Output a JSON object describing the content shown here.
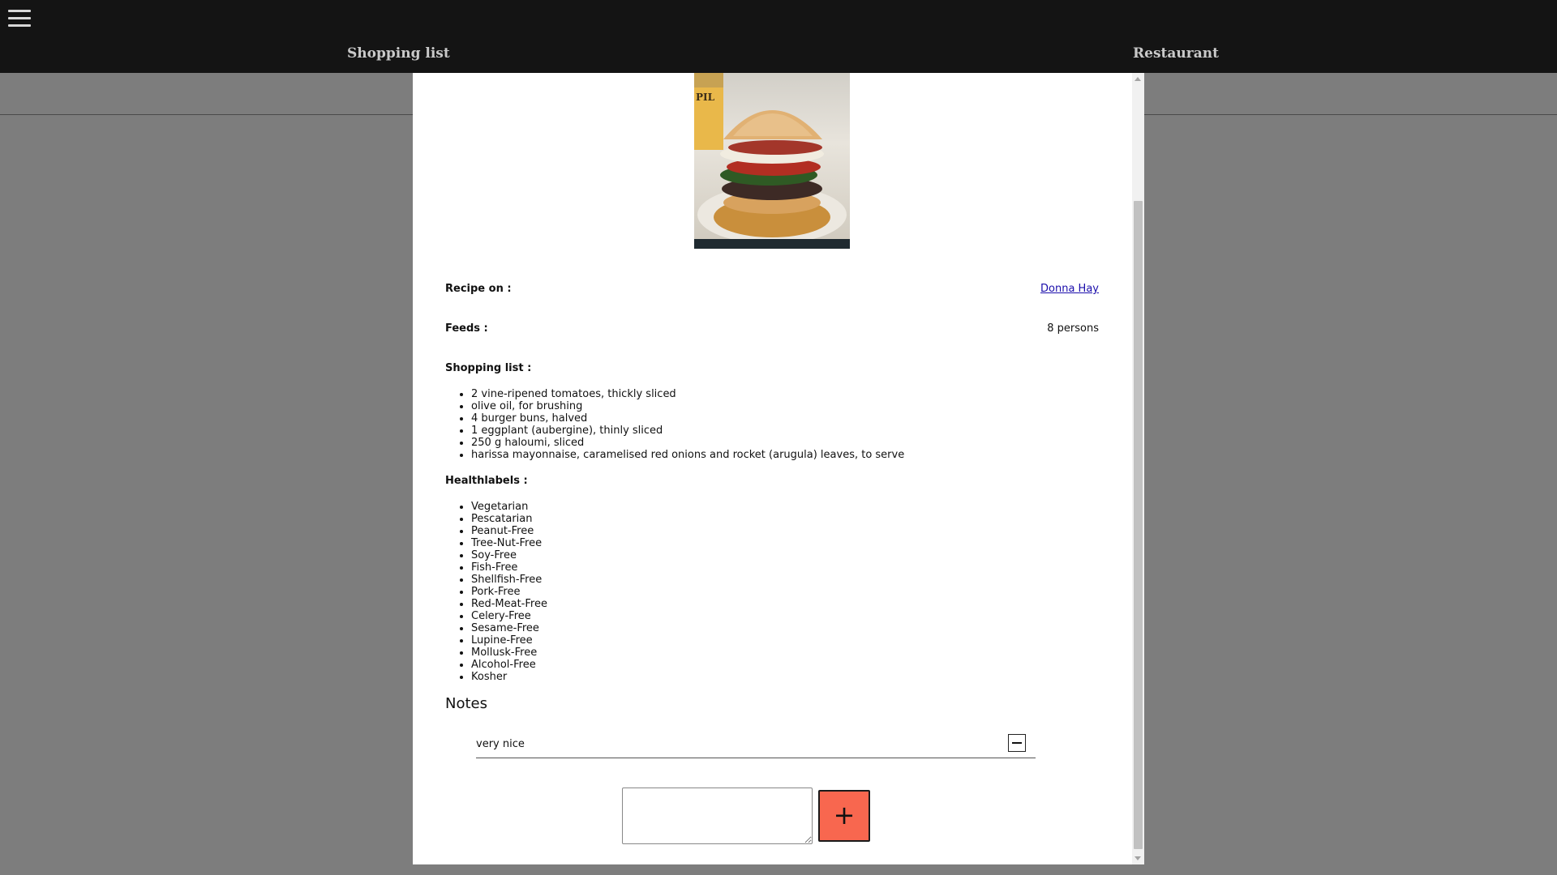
{
  "nav": {
    "shopping_list": "Shopping list",
    "restaurant": "Restaurant"
  },
  "recipe": {
    "recipe_on_label": "Recipe on :",
    "recipe_on_value": "Donna Hay",
    "feeds_label": "Feeds :",
    "feeds_value": "8 persons",
    "shopping_list_label": "Shopping list :",
    "ingredients": [
      "2 vine-ripened tomatoes, thickly sliced",
      "olive oil, for brushing",
      "4 burger buns, halved",
      "1 eggplant (aubergine), thinly sliced",
      "250 g haloumi, sliced",
      "harissa mayonnaise, caramelised red onions and rocket (arugula) leaves, to serve"
    ],
    "healthlabels_label": "Healthlabels :",
    "healthlabels": [
      "Vegetarian",
      "Pescatarian",
      "Peanut-Free",
      "Tree-Nut-Free",
      "Soy-Free",
      "Fish-Free",
      "Shellfish-Free",
      "Pork-Free",
      "Red-Meat-Free",
      "Celery-Free",
      "Sesame-Free",
      "Lupine-Free",
      "Mollusk-Free",
      "Alcohol-Free",
      "Kosher"
    ]
  },
  "notes": {
    "title": "Notes",
    "items": [
      "very nice"
    ],
    "new_note_value": "",
    "add_label": "+"
  },
  "colors": {
    "topbar": "#141414",
    "overlay": "#7d7d7d",
    "add_button": "#f8674f",
    "link": "#1a0dab"
  },
  "icons": {
    "menu": "hamburger-icon",
    "remove_note": "minus-icon",
    "add_note": "plus-icon"
  }
}
